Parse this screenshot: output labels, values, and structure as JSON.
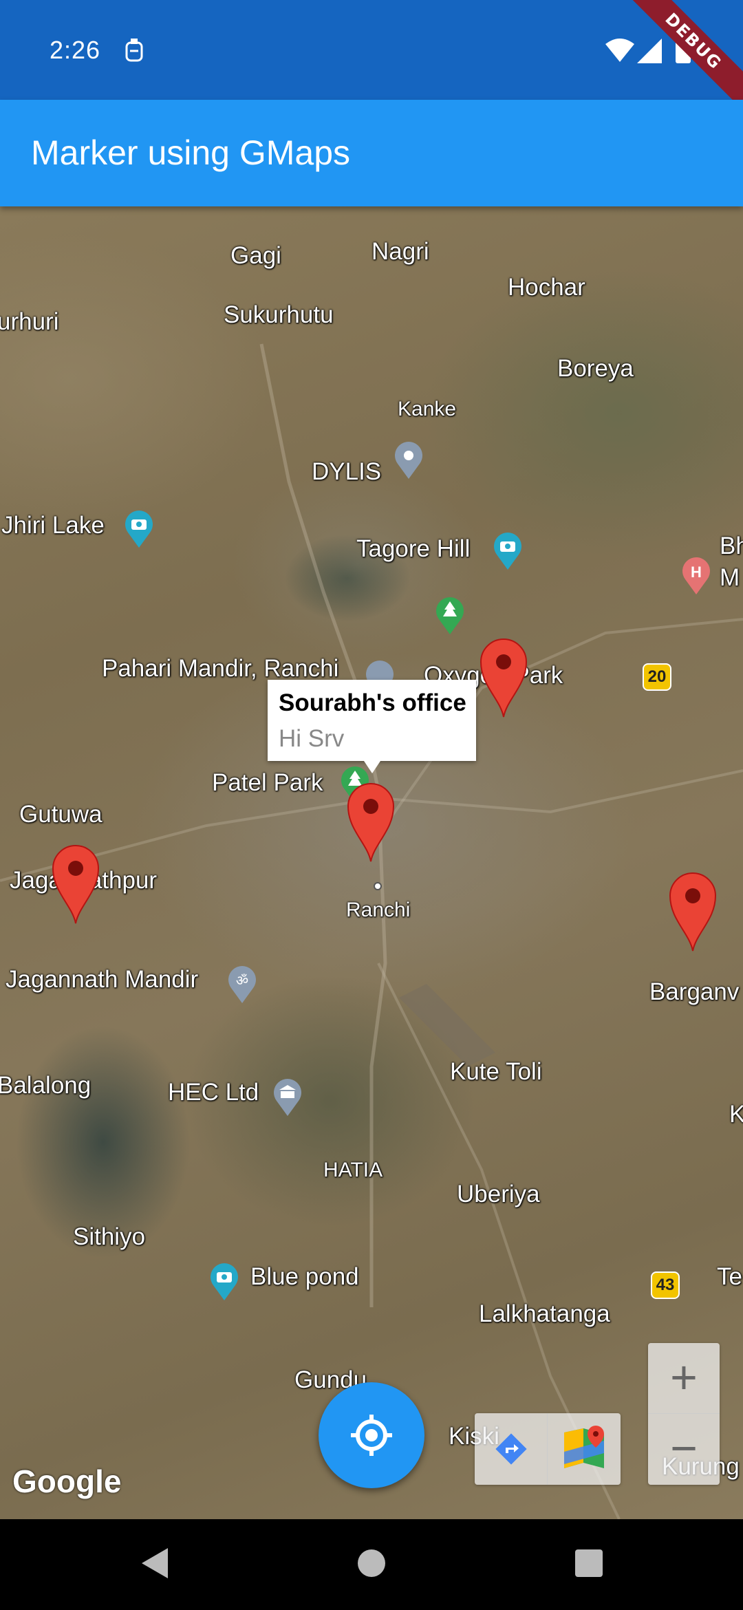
{
  "status_bar": {
    "time": "2:26",
    "debug_banner": "DEBUG"
  },
  "app_bar": {
    "title": "Marker using GMaps"
  },
  "map": {
    "labels": {
      "gagi": "Gagi",
      "nagri": "Nagri",
      "hochar": "Hochar",
      "urhuri": "urhuri",
      "sukurhutu": "Sukurhutu",
      "kanke": "Kanke",
      "boreya": "Boreya",
      "dylis": "DYLIS",
      "jhiri_lake": "Jhiri Lake",
      "tagore_hill": "Tagore Hill",
      "bh": "Bh",
      "m": "M",
      "pahari_mandir": "Pahari Mandir, Ranchi",
      "oxygen_park": "Oxygen Park",
      "patel_park": "Patel Park",
      "gutuwa": "Gutuwa",
      "jagannathpur": "Jagannathpur",
      "ranchi": "Ranchi",
      "barganv": "Barganv",
      "jagannath_mandir": "Jagannath Mandir",
      "balalong": "Balalong",
      "kute_toli": "Kute Toli",
      "hec_ltd": "HEC Ltd",
      "k": "K",
      "hatia": "HATIA",
      "uberiya": "Uberiya",
      "sithiyo": "Sithiyo",
      "blue_pond": "Blue pond",
      "te": "Te",
      "lalkhatanga": "Lalkhatanga",
      "gundu": "Gundu",
      "kiski": "Kiski",
      "kurung": "Kurung"
    },
    "shields": {
      "nh20": "20",
      "nh43": "43"
    },
    "info_window": {
      "title": "Sourabh's office",
      "snippet": "Hi Srv"
    },
    "zoom_in": "+",
    "zoom_out": "−",
    "attribution": "Google"
  },
  "colors": {
    "status_bar": "#1565c0",
    "app_bar": "#2196f3",
    "fab": "#2196f3",
    "marker": "#ea4335",
    "poi_teal": "#24a8c8",
    "poi_green": "#34a853",
    "poi_gray": "#8a9bb0"
  }
}
